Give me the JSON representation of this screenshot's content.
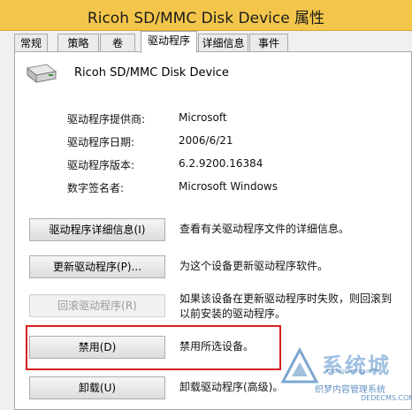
{
  "window": {
    "title": "Ricoh SD/MMC Disk Device 属性"
  },
  "tabs": [
    {
      "label": "常规"
    },
    {
      "label": "策略"
    },
    {
      "label": "卷"
    },
    {
      "label": "驱动程序"
    },
    {
      "label": "详细信息"
    },
    {
      "label": "事件"
    }
  ],
  "device": {
    "name": "Ricoh SD/MMC Disk Device",
    "icon": "disk-drive-icon"
  },
  "driver_info": {
    "provider_label": "驱动程序提供商:",
    "provider_value": "Microsoft",
    "date_label": "驱动程序日期:",
    "date_value": "2006/6/21",
    "version_label": "驱动程序版本:",
    "version_value": "6.2.9200.16384",
    "signer_label": "数字签名者:",
    "signer_value": "Microsoft Windows"
  },
  "actions": {
    "details_button": "驱动程序详细信息(I)",
    "details_desc": "查看有关驱动程序文件的详细信息。",
    "update_button": "更新驱动程序(P)...",
    "update_desc": "为这个设备更新驱动程序软件。",
    "rollback_button": "回滚驱动程序(R)",
    "rollback_desc_line1": "如果该设备在更新驱动程序时失败，则回滚到",
    "rollback_desc_line2": "以前安装的驱动程序。",
    "disable_button": "禁用(D)",
    "disable_desc": "禁用所选设备。",
    "uninstall_button": "卸载(U)",
    "uninstall_desc": "卸载驱动程序(高级)。"
  },
  "watermark": {
    "brand": "系统城",
    "small": "xitongcheng.com",
    "line1": "织梦内容管理系统",
    "line2": "DEDECMS.COM"
  },
  "colors": {
    "titlebar": "#f3c64b",
    "highlight": "#d42020"
  }
}
